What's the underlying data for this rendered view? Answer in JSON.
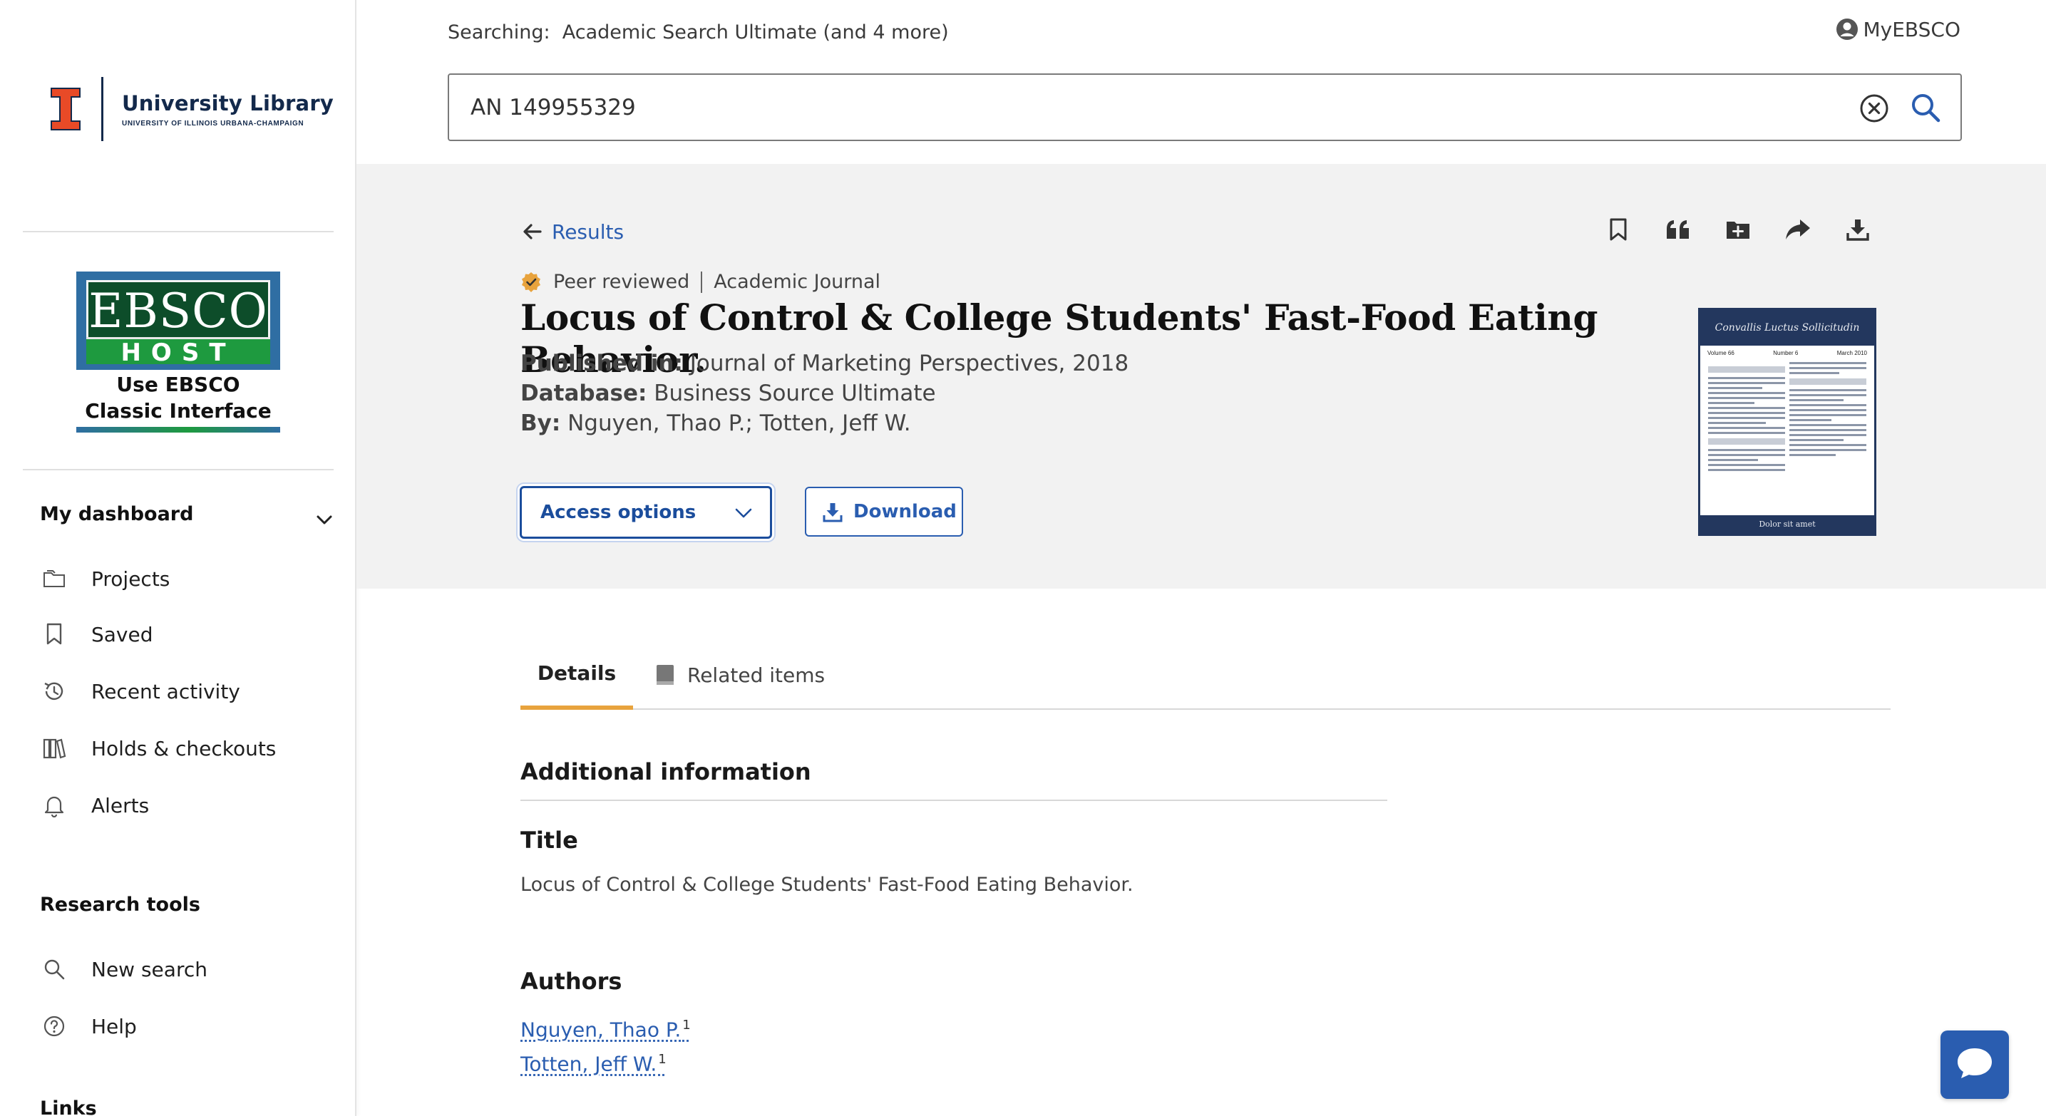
{
  "brand": {
    "university_name": "University Library",
    "university_sub": "UNIVERSITY OF ILLINOIS URBANA-CHAMPAIGN",
    "ebsco_word": "EBSCO",
    "ebsco_host_word": "HOST",
    "ebsco_classic_caption": "Use EBSCO Classic Interface"
  },
  "sidebar": {
    "dashboard_label": "My dashboard",
    "dashboard_items": [
      {
        "label": "Projects",
        "icon": "folder-icon"
      },
      {
        "label": "Saved",
        "icon": "bookmark-icon"
      },
      {
        "label": "Recent activity",
        "icon": "history-icon"
      },
      {
        "label": "Holds & checkouts",
        "icon": "books-icon"
      },
      {
        "label": "Alerts",
        "icon": "bell-icon"
      }
    ],
    "research_tools_label": "Research tools",
    "research_items": [
      {
        "label": "New search",
        "icon": "search-icon"
      },
      {
        "label": "Help",
        "icon": "help-icon"
      }
    ],
    "links_label": "Links"
  },
  "header": {
    "searching_prefix": "Searching:",
    "searching_databases": "Academic Search Ultimate (and 4 more)",
    "account_label": "MyEBSCO",
    "search_value": "AN 149955329"
  },
  "record": {
    "back_label": "Results",
    "toolbar_icons": [
      "bookmark-icon",
      "cite-icon",
      "add-to-folder-icon",
      "share-icon",
      "download-icon"
    ],
    "peer_reviewed_label": "Peer reviewed",
    "publication_type": "Academic Journal",
    "title": "Locus of Control & College Students' Fast-Food Eating Behavior.",
    "published_label": "Published in:",
    "published_value": "Journal of Marketing Perspectives, 2018",
    "database_label": "Database:",
    "database_value": "Business Source Ultimate",
    "by_label": "By:",
    "by_value": "Nguyen, Thao P.; Totten, Jeff W.",
    "access_options_label": "Access options",
    "download_label": "Download",
    "cover": {
      "masthead": "Convallis Luctus Sollicitudin",
      "volume": "Volume 66",
      "number": "Number 6",
      "date": "March 2010",
      "footer": "Dolor sit amet"
    }
  },
  "tabs": {
    "details": "Details",
    "related": "Related items"
  },
  "details": {
    "section_title": "Additional information",
    "title_label": "Title",
    "title_value": "Locus of Control & College Students' Fast-Food Eating Behavior.",
    "authors_label": "Authors",
    "authors": [
      {
        "name": "Nguyen, Thao P.",
        "affiliation": "1"
      },
      {
        "name": "Totten, Jeff W.",
        "affiliation": "1"
      }
    ]
  },
  "colors": {
    "link_blue": "#2a5db0",
    "illinois_orange": "#e84a27",
    "illinois_navy": "#13294b",
    "tab_accent": "#e8a33d",
    "peer_badge": "#e8a33d"
  }
}
